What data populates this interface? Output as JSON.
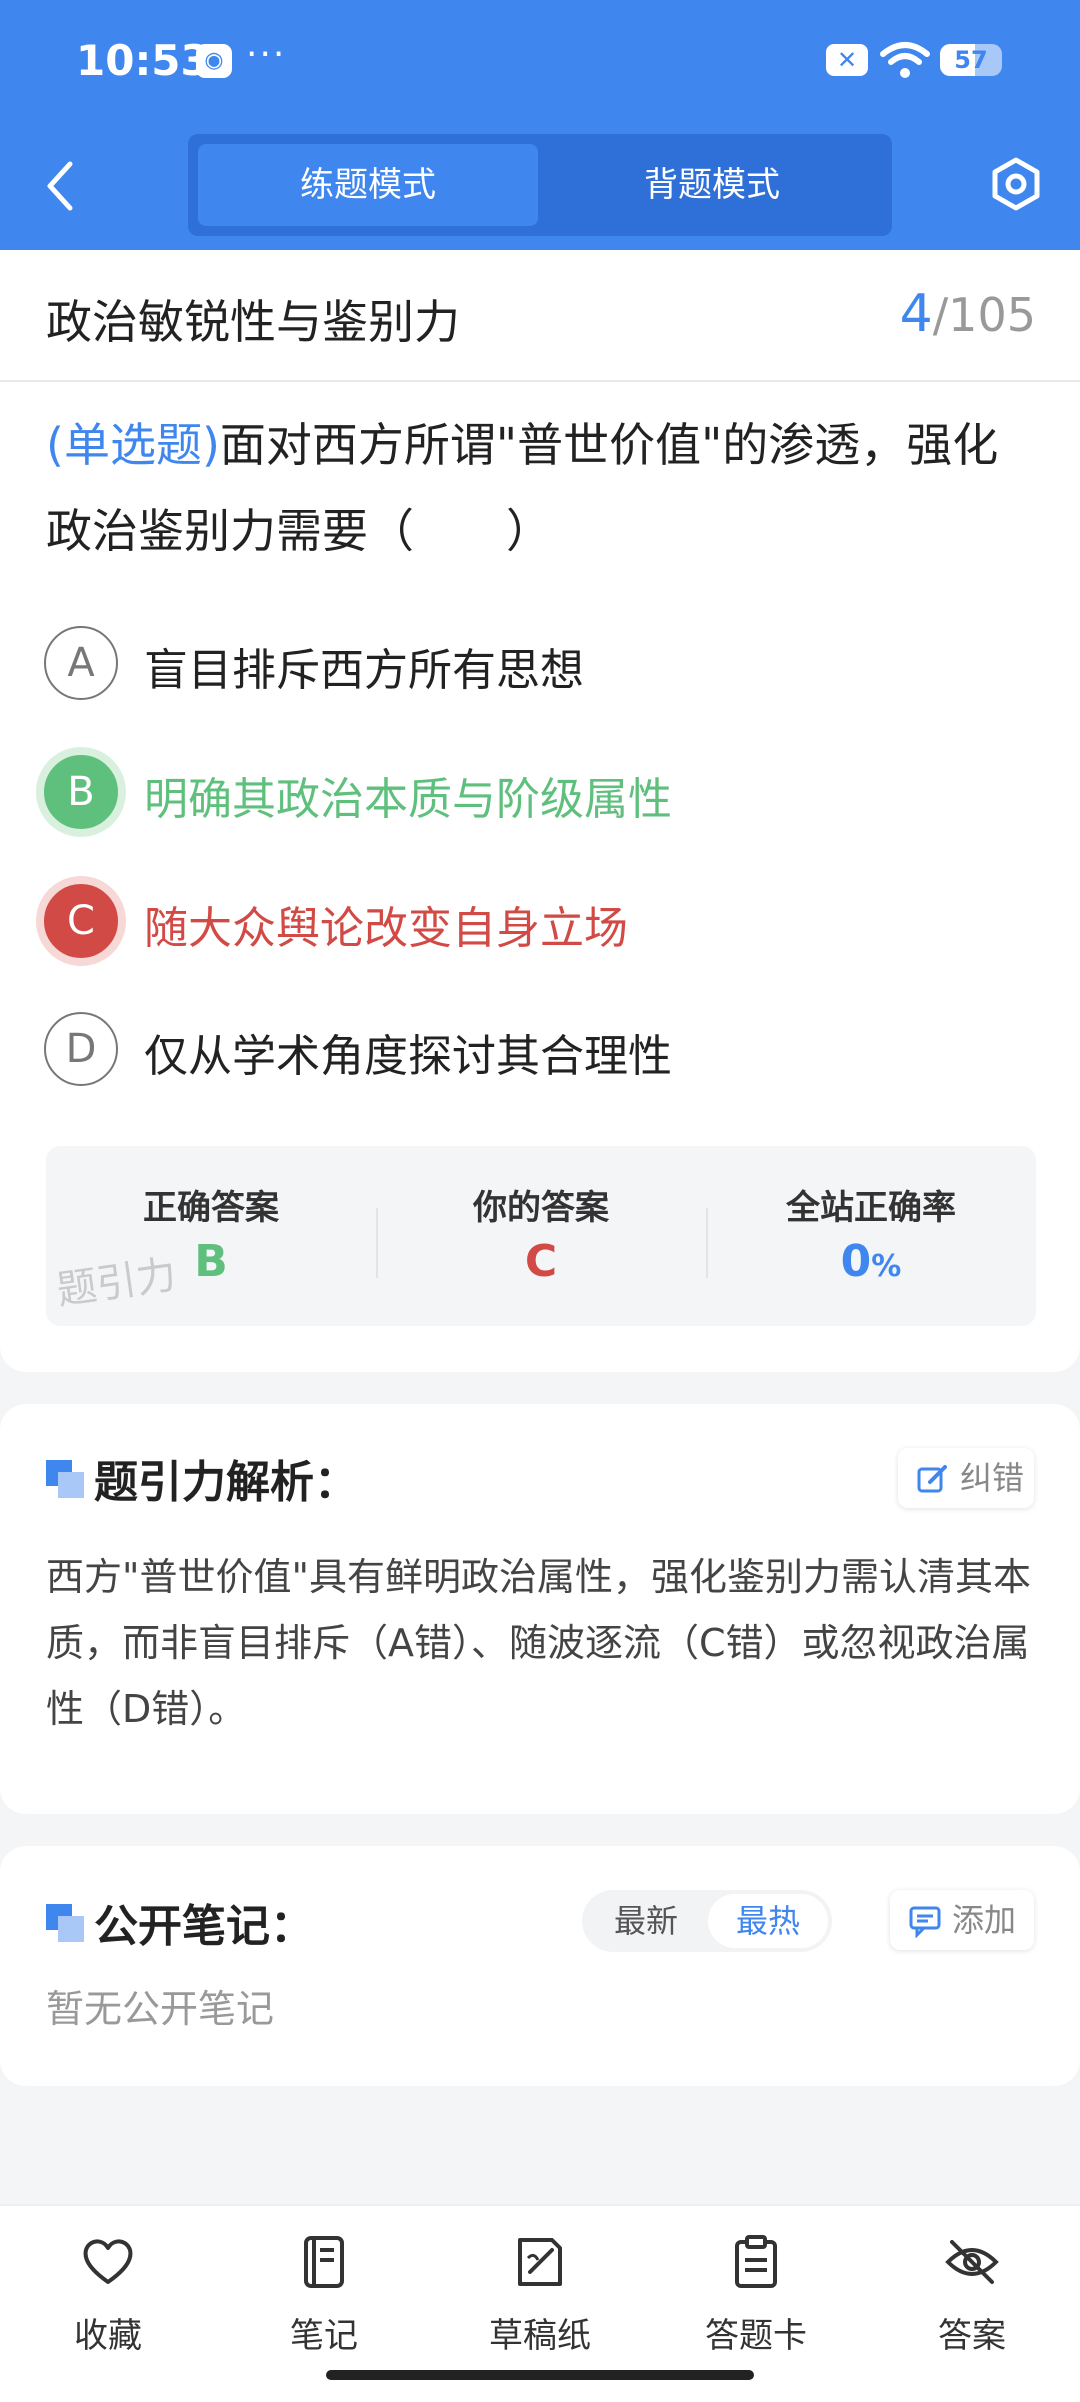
{
  "status_bar": {
    "time": "10:53",
    "dots": "···",
    "battery": "57",
    "battery_level": 0.57
  },
  "header": {
    "tabs": [
      {
        "label": "练题模式",
        "active": true
      },
      {
        "label": "背题模式",
        "active": false
      }
    ],
    "accent_color": "#3f86ee"
  },
  "title_bar": {
    "title": "政治敏锐性与鉴别力",
    "current": "4",
    "total": "/105"
  },
  "question": {
    "type_tag": "(单选题)",
    "text": "面对西方所谓\"普世价值\"的渗透，强化政治鉴别力需要（　　）",
    "options": [
      {
        "letter": "A",
        "text": "盲目排斥西方所有思想",
        "state": "normal"
      },
      {
        "letter": "B",
        "text": "明确其政治本质与阶级属性",
        "state": "correct"
      },
      {
        "letter": "C",
        "text": "随大众舆论改变自身立场",
        "state": "wrong"
      },
      {
        "letter": "D",
        "text": "仅从学术角度探讨其合理性",
        "state": "normal"
      }
    ],
    "stats": {
      "correct_label": "正确答案",
      "correct_value": "B",
      "yours_label": "你的答案",
      "yours_value": "C",
      "rate_label": "全站正确率",
      "rate_value": "0",
      "rate_unit": "%"
    },
    "watermark": "题引力"
  },
  "analysis": {
    "title": "题引力解析：",
    "report_label": "纠错",
    "text": "西方\"普世价值\"具有鲜明政治属性，强化鉴别力需认清其本质，而非盲目排斥（A错）、随波逐流（C错）或忽视政治属性（D错）。"
  },
  "notes": {
    "title": "公开笔记：",
    "sort_latest": "最新",
    "sort_hot": "最热",
    "add_label": "添加",
    "empty": "暂无公开笔记"
  },
  "bottom_nav": [
    {
      "label": "收藏",
      "icon": "heart-icon"
    },
    {
      "label": "笔记",
      "icon": "notebook-icon"
    },
    {
      "label": "草稿纸",
      "icon": "draft-paper-icon"
    },
    {
      "label": "答题卡",
      "icon": "answer-sheet-icon"
    },
    {
      "label": "答案",
      "icon": "eye-off-icon"
    }
  ],
  "colors": {
    "correct": "#5fc07d",
    "wrong": "#d24a45",
    "accent": "#3f86ee"
  }
}
